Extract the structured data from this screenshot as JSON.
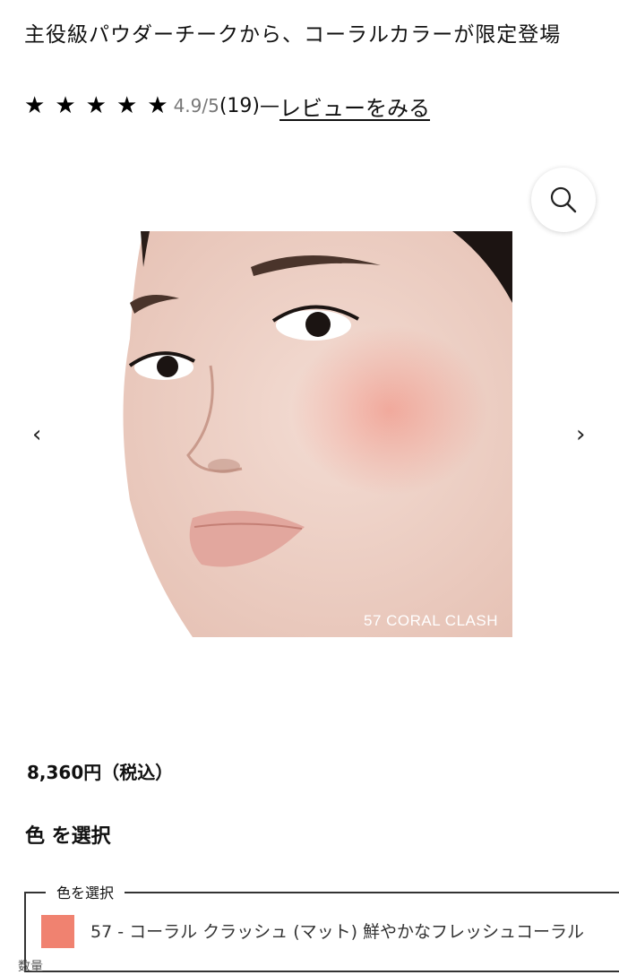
{
  "product": {
    "title": "主役級パウダーチークから、コーラルカラーが限定登場"
  },
  "rating": {
    "stars": 5,
    "value_text": "4.9/5",
    "count_text": "(19)",
    "separator": "—",
    "review_link_label": "レビューをみる"
  },
  "gallery": {
    "zoom_icon": "search-icon",
    "prev_label": "‹",
    "next_label": "›",
    "image_caption": "57 CORAL CLASH"
  },
  "price": {
    "text": "8,360円（税込）"
  },
  "shade_selector": {
    "heading": "色 を選択",
    "legend": "色を選択",
    "selected_label": "57 - コーラル クラッシュ (マット) 鮮やかなフレッシュコーラル",
    "swatch_color": "#f08270"
  },
  "quantity": {
    "label": "数量"
  }
}
